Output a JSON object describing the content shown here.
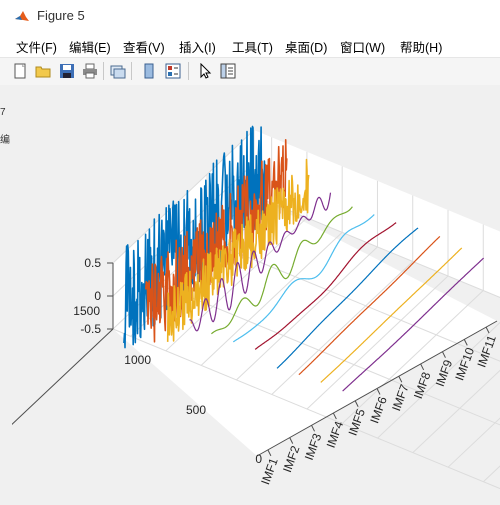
{
  "window": {
    "title": "Figure 5"
  },
  "menu": [
    "文件(F)",
    "编辑(E)",
    "查看(V)",
    "插入(I)",
    "工具(T)",
    "桌面(D)",
    "窗口(W)",
    "帮助(H)"
  ],
  "toolbar": [
    "new-figure",
    "open-file",
    "save",
    "print",
    "link-plot",
    "hide-plot-tools",
    "show-plot-tools",
    "edit-plot",
    "property-inspector"
  ],
  "left_strip": {
    "top_label": "7",
    "second_label": "编"
  },
  "chart_data": {
    "type": "line",
    "view": "3d",
    "z_ticks": [
      "0.5",
      "0",
      "-0.5"
    ],
    "y_ticks": [
      "1500",
      "1000",
      "500",
      "0"
    ],
    "x_tick_labels": [
      "IMF1",
      "IMF2",
      "IMF3",
      "IMF4",
      "IMF5",
      "IMF6",
      "IMF7",
      "IMF8",
      "IMF9",
      "IMF10",
      "IMF11"
    ],
    "zlim": [
      -0.5,
      0.5
    ],
    "ylim": [
      0,
      1500
    ],
    "grid": true,
    "series_colors": [
      "#0072bd",
      "#d95319",
      "#edb120",
      "#7e2f8e",
      "#77ac30",
      "#4dbeee",
      "#a2142f",
      "#0072bd",
      "#d95319",
      "#edb120",
      "#7e2f8e",
      "#77ac30",
      "#4dbeee",
      "#a2142f"
    ]
  }
}
